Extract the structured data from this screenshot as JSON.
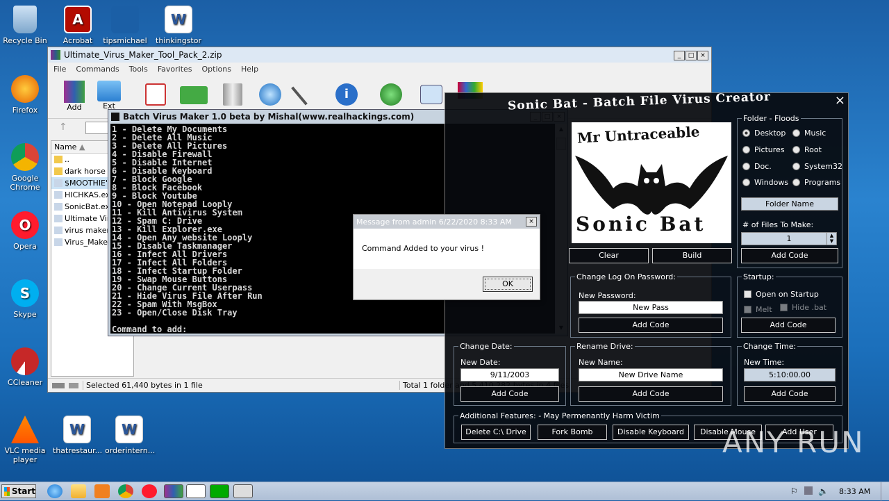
{
  "desktop": {
    "icons": [
      {
        "label": "Recycle Bin",
        "icon": "recycle-bin-icon"
      },
      {
        "label": "Acrobat",
        "icon": "acrobat-icon"
      },
      {
        "label": "tipsmichael",
        "icon": "file-icon"
      },
      {
        "label": "thinkingstor",
        "icon": "word-doc-icon"
      },
      {
        "label": "Firefox",
        "icon": "firefox-icon"
      },
      {
        "label": "Google Chrome",
        "icon": "chrome-icon"
      },
      {
        "label": "Opera",
        "icon": "opera-icon"
      },
      {
        "label": "Skype",
        "icon": "skype-icon"
      },
      {
        "label": "CCleaner",
        "icon": "ccleaner-icon"
      },
      {
        "label": "VLC media player",
        "icon": "vlc-icon"
      },
      {
        "label": "thatrestaur...",
        "icon": "word-doc-icon"
      },
      {
        "label": "orderintern...",
        "icon": "word-doc-icon"
      }
    ]
  },
  "winrar": {
    "title": "Ultimate_Virus_Maker_Tool_Pack_2.zip",
    "menu": [
      "File",
      "Commands",
      "Tools",
      "Favorites",
      "Options",
      "Help"
    ],
    "toolbar": [
      "Add",
      "Ext"
    ],
    "column_name": "Name",
    "files": [
      "..",
      "dark horse tr",
      "$MOOTHIE's",
      "HICHKAS.ex",
      "SonicBat.exe",
      "Ultimate Viru",
      "virus maker .",
      "Virus_Maker."
    ],
    "status_left": "Selected 61,440 bytes in 1 file",
    "status_right": "Total 1 folder and 5,410,282 bytes in 4 files"
  },
  "console": {
    "title": "Batch Virus Maker 1.0 beta by Mishal(www.realhackings.com)",
    "lines": [
      "1 - Delete My Documents",
      "2 - Delete All Music",
      "3 - Delete All Pictures",
      "4 - Disable Firewall",
      "5 - Disable Internet",
      "6 - Disable Keyboard",
      "7 - Block Google",
      "8 - Block Facebook",
      "9 - Block Youtube",
      "10 - Open Notepad Looply",
      "11 - Kill Antivirus System",
      "12 - Spam C: Drive",
      "13 - Kill Explorer.exe",
      "14 - Open Any website Looply",
      "15 - Disable Taskmanager",
      "16 - Infect All Drivers",
      "17 - Infect All Folders",
      "18 - Infect Startup Folder",
      "19 - Swap Mouse Buttons",
      "20 - Change Current Userpass",
      "21 - Hide Virus File After Run",
      "22 - Spam With MsgBox",
      "23 - Open/Close Disk Tray",
      "",
      "Command to add:"
    ]
  },
  "msgbox": {
    "title": "Message from admin 6/22/2020 8:33 AM",
    "text": "Command Added to your virus !",
    "ok": "OK"
  },
  "sonicbat": {
    "title": "Sonic Bat - Batch File Virus Creator",
    "logo_top": "Mr Untraceable",
    "logo_bottom": "Sonic Bat",
    "folder_floods": {
      "legend": "Folder - Floods",
      "options": [
        {
          "label": "Desktop",
          "checked": true
        },
        {
          "label": "Music",
          "checked": false
        },
        {
          "label": "Pictures",
          "checked": false
        },
        {
          "label": "Root",
          "checked": false
        },
        {
          "label": "Doc.",
          "checked": false
        },
        {
          "label": "System32",
          "checked": false
        },
        {
          "label": "Windows",
          "checked": false
        },
        {
          "label": "Programs",
          "checked": false
        }
      ],
      "folder_name": "Folder Name",
      "files_label": "# of Files To Make:",
      "files_value": "1",
      "add": "Add Code"
    },
    "clear": "Clear",
    "build": "Build",
    "logon": {
      "legend": "Change Log On Password:",
      "label": "New Password:",
      "value": "New Pass",
      "add": "Add Code"
    },
    "startup": {
      "legend": "Startup:",
      "open": "Open on Startup",
      "melt": "Melt",
      "hide": "Hide .bat",
      "add": "Add Code"
    },
    "date": {
      "legend": "Change Date:",
      "label": "New Date:",
      "value": "9/11/2003",
      "add": "Add Code"
    },
    "drive": {
      "legend": "Rename Drive:",
      "label": "New Name:",
      "value": "New Drive Name",
      "add": "Add Code"
    },
    "time": {
      "legend": "Change Time:",
      "label": "New Time:",
      "value": "5:10:00.00",
      "add": "Add Code"
    },
    "additional": {
      "legend": "Additional Features:   - May Permenantly Harm Victim",
      "buttons": [
        "Delete C:\\ Drive",
        "Fork Bomb",
        "Disable Keyboard",
        "Disable Mouse",
        "Add User"
      ]
    }
  },
  "taskbar": {
    "start": "Start",
    "clock": "8:33 AM"
  },
  "watermark": "ANY RUN"
}
